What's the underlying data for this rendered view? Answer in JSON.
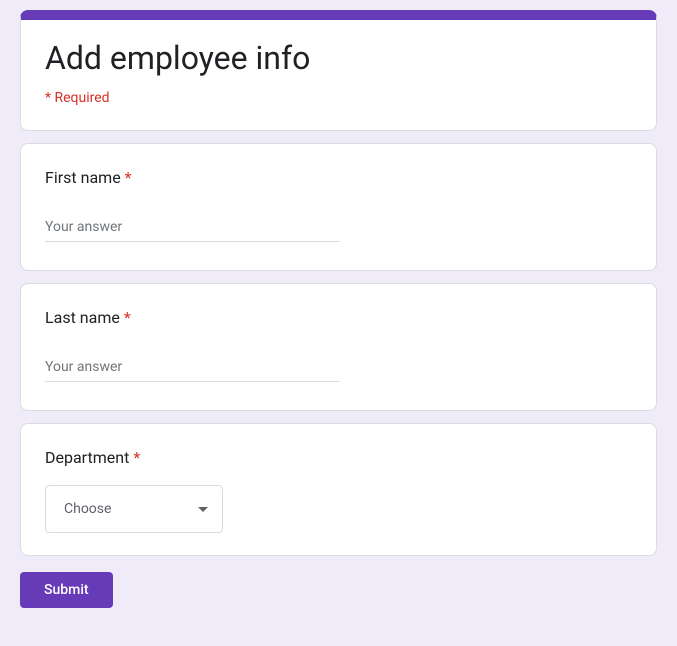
{
  "header": {
    "title": "Add employee info",
    "requiredNote": "* Required"
  },
  "questions": {
    "firstName": {
      "label": "First name",
      "asterisk": "*",
      "placeholder": "Your answer"
    },
    "lastName": {
      "label": "Last name",
      "asterisk": "*",
      "placeholder": "Your answer"
    },
    "department": {
      "label": "Department",
      "asterisk": "*",
      "selected": "Choose"
    }
  },
  "submit": {
    "label": "Submit"
  }
}
